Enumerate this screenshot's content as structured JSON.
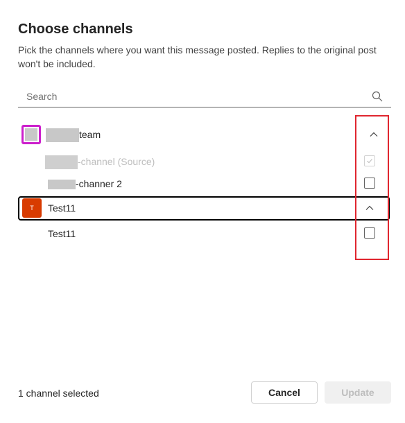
{
  "dialog": {
    "title": "Choose channels",
    "description": "Pick the channels where you want this message posted. Replies to the original post won't be included."
  },
  "search": {
    "placeholder": "Search",
    "value": ""
  },
  "teams": [
    {
      "name_suffix": "team",
      "name_redacted": true,
      "avatar_color": "#cc1fcc",
      "expanded": true,
      "channels": [
        {
          "label_suffix": "-channel (Source)",
          "label_redacted": true,
          "checked": true,
          "disabled": true
        },
        {
          "label_suffix": "-channer 2",
          "label_redacted": true,
          "checked": false,
          "disabled": false
        }
      ]
    },
    {
      "name": "Test11",
      "avatar_letter": "T",
      "avatar_color": "#d83b01",
      "expanded": true,
      "focused": true,
      "channels": [
        {
          "label": "Test11",
          "checked": false,
          "disabled": false
        }
      ]
    }
  ],
  "footer": {
    "status": "1 channel selected",
    "cancel_label": "Cancel",
    "update_label": "Update",
    "update_disabled": true
  },
  "annotation": {
    "highlight_color": "#e0262f"
  }
}
